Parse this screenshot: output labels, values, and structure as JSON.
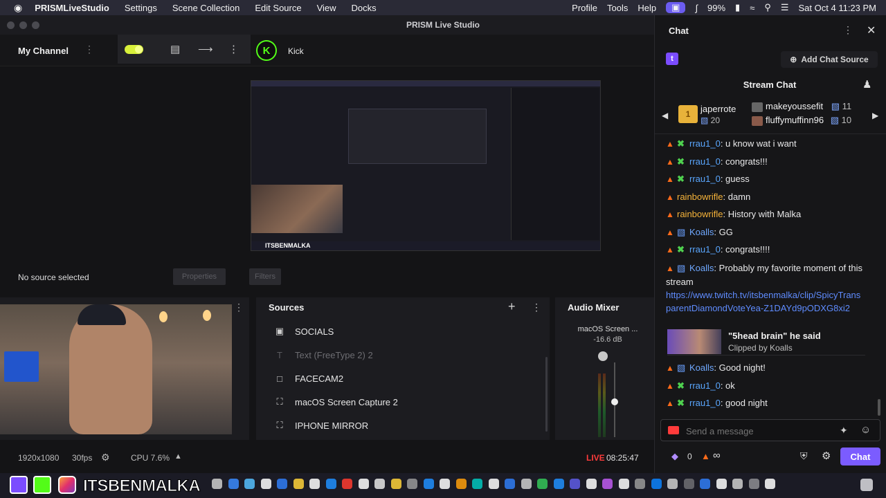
{
  "menubar": {
    "app_name": "PRISMLiveStudio",
    "items": [
      "Settings",
      "Scene Collection",
      "Edit Source",
      "View",
      "Docks"
    ],
    "right_items": [
      "Profile",
      "Tools",
      "Help"
    ],
    "battery": "99%",
    "clock": "Sat Oct 4  11:23 PM"
  },
  "window": {
    "title": "PRISM Live Studio"
  },
  "channel": {
    "label": "My Channel",
    "platform": "Kick"
  },
  "preview": {
    "no_source": "No source selected",
    "properties": "Properties",
    "filters": "Filters",
    "overlay_text": "ITSBENMALKA"
  },
  "sources": {
    "title": "Sources",
    "items": [
      {
        "label": "SOCIALS",
        "icon": "image-icon",
        "dim": false
      },
      {
        "label": "Text (FreeType 2) 2",
        "icon": "text-icon",
        "dim": true
      },
      {
        "label": "FACECAM2",
        "icon": "camera-icon",
        "dim": false
      },
      {
        "label": "macOS Screen Capture 2",
        "icon": "screen-capture-icon",
        "dim": false
      },
      {
        "label": "IPHONE MIRROR",
        "icon": "screen-capture-icon",
        "dim": false
      }
    ]
  },
  "mixer": {
    "title": "Audio Mixer",
    "channel": "macOS Screen ...",
    "db": "-16.6 dB"
  },
  "statusbar": {
    "resolution": "1920x1080",
    "fps": "30fps",
    "cpu": "CPU 7.6%",
    "live": "LIVE",
    "timer": "08:25:47"
  },
  "chat": {
    "title": "Chat",
    "add_source": "Add Chat Source",
    "stream_chat": "Stream Chat",
    "gifters": [
      {
        "name": "japerrote",
        "count": "20"
      },
      {
        "name": "makeyoussefit",
        "count": "11"
      },
      {
        "name": "fluffymuffinn96",
        "count": "10"
      }
    ],
    "messages": [
      {
        "user": "rrau1_0",
        "ucls": "u-rrau",
        "badge": "swx",
        "text": ": u know wat i want"
      },
      {
        "user": "rrau1_0",
        "ucls": "u-rrau",
        "badge": "swx",
        "text": ": congrats!!!"
      },
      {
        "user": "rrau1_0",
        "ucls": "u-rrau",
        "badge": "swx",
        "text": ": guess"
      },
      {
        "user": "rainbowrifle",
        "ucls": "u-rain",
        "badge": "",
        "text": ": damn"
      },
      {
        "user": "rainbowrifle",
        "ucls": "u-rain",
        "badge": "",
        "text": ": History with Malka"
      },
      {
        "user": "Koalls",
        "ucls": "u-koa",
        "badge": "gift",
        "text": ": GG"
      },
      {
        "user": "rrau1_0",
        "ucls": "u-rrau",
        "badge": "swx",
        "text": ": congrats!!!!"
      }
    ],
    "long_msg": {
      "user": "Koalls",
      "text": ": Probably my favorite moment of this stream",
      "link": "https://www.twitch.tv/itsbenmalka/clip/SpicyTransparentDiamondVoteYea-Z1DAYd9pODXG8xi2"
    },
    "clip": {
      "title": "\"5head brain\" he said",
      "by": "Clipped by Koalls"
    },
    "after_messages": [
      {
        "user": "Koalls",
        "ucls": "u-koa",
        "badge": "gift",
        "text": ": Good night!"
      },
      {
        "user": "rrau1_0",
        "ucls": "u-rrau",
        "badge": "swx",
        "text": ": ok"
      },
      {
        "user": "rrau1_0",
        "ucls": "u-rrau",
        "badge": "swx",
        "text": ": good night"
      }
    ],
    "input_placeholder": "Send a message",
    "points": "0",
    "chat_button": "Chat"
  },
  "colors": {
    "accent": "#7b5cff",
    "live": "#ff3b3b",
    "toggle": "#d8f03a",
    "kick": "#53fc18"
  }
}
